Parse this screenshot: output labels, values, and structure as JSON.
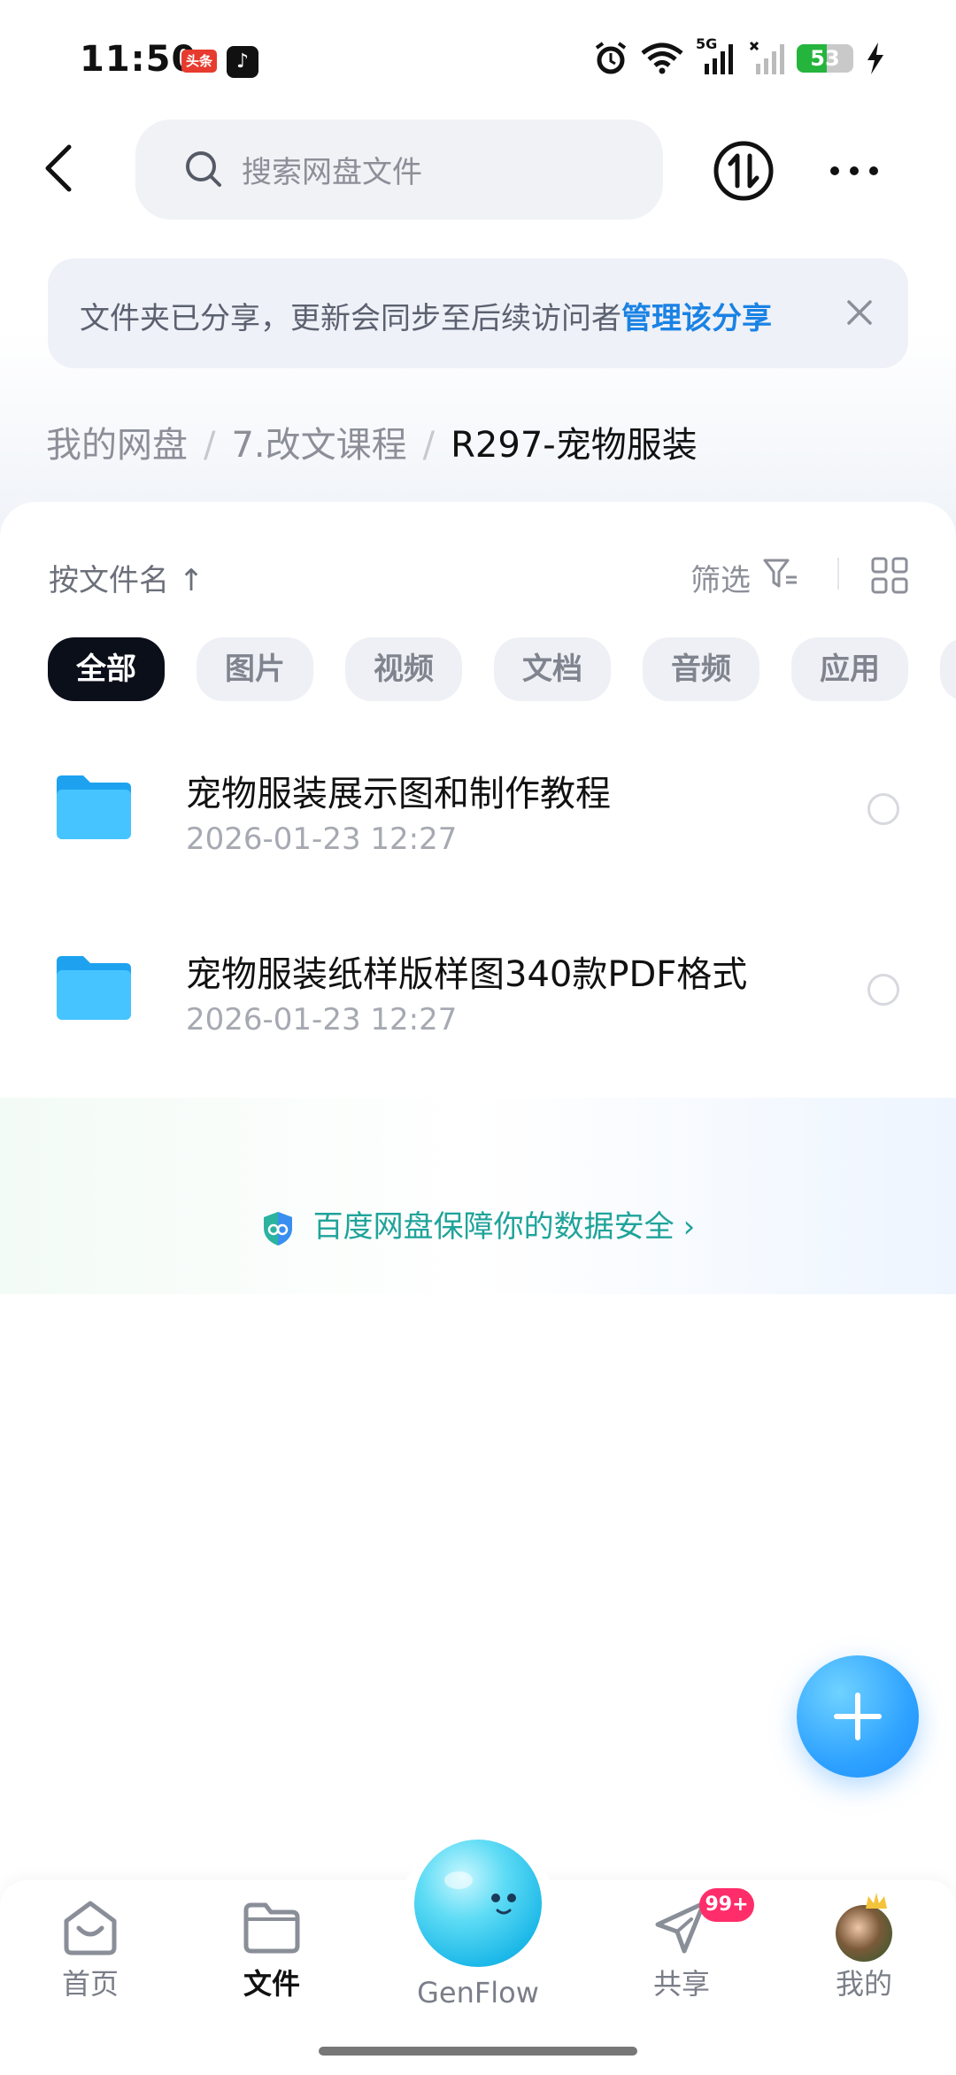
{
  "status_bar": {
    "time": "11:50",
    "app_badge_1": "头条",
    "network": "5G",
    "battery": "53",
    "battery_level": 0.53
  },
  "header": {
    "search_placeholder": "搜索网盘文件"
  },
  "notice": {
    "text": "文件夹已分享，更新会同步至后续访问者",
    "link": "管理该分享"
  },
  "breadcrumb": {
    "items": [
      "我的网盘",
      "7.改文课程",
      "R297-宠物服装"
    ],
    "separator": "/"
  },
  "toolbar": {
    "sort_label": "按文件名",
    "sort_arrow": "↑",
    "filter_label": "筛选"
  },
  "chips": [
    "全部",
    "图片",
    "视频",
    "文档",
    "音频",
    "应用"
  ],
  "files": [
    {
      "name": "宠物服装展示图和制作教程",
      "date": "2026-01-23  12:27"
    },
    {
      "name": "宠物服装纸样版样图340款PDF格式",
      "date": "2026-01-23  12:27"
    }
  ],
  "safety": {
    "text": "百度网盘保障你的数据安全",
    "arrow": "›"
  },
  "tabbar": {
    "tabs": [
      {
        "label": "首页"
      },
      {
        "label": "文件"
      },
      {
        "label": "GenFlow"
      },
      {
        "label": "共享"
      },
      {
        "label": "我的"
      }
    ],
    "share_badge": "99+"
  },
  "colors": {
    "accent": "#1a82e4",
    "safety": "#1fa39a",
    "badge": "#ff2d6a",
    "active_chip": "#0b0f1a"
  }
}
